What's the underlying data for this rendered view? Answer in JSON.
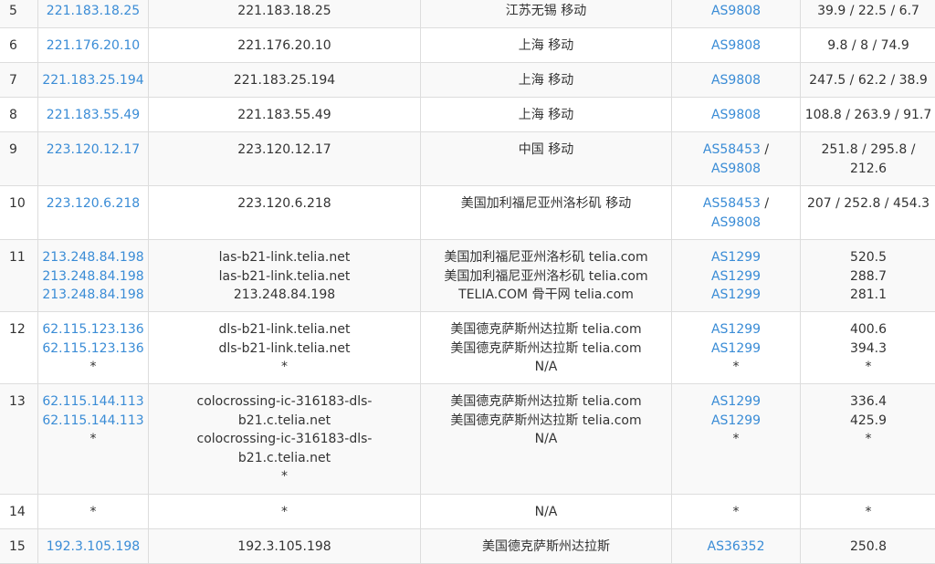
{
  "colors": {
    "link": "#3a8cd6",
    "text": "#333333",
    "row_stripe": "#f9f9f9",
    "border": "#dddddd"
  },
  "rows": [
    {
      "hop": "5",
      "ips": [
        "221.183.18.25"
      ],
      "hosts": [
        "221.183.18.25"
      ],
      "locations": [
        "江苏无锡 移动"
      ],
      "asn": [
        "AS9808"
      ],
      "times": [
        "39.9 / 22.5 / 6.7"
      ]
    },
    {
      "hop": "6",
      "ips": [
        "221.176.20.10"
      ],
      "hosts": [
        "221.176.20.10"
      ],
      "locations": [
        "上海 移动"
      ],
      "asn": [
        "AS9808"
      ],
      "times": [
        "9.8 / 8 / 74.9"
      ]
    },
    {
      "hop": "7",
      "ips": [
        "221.183.25.194"
      ],
      "hosts": [
        "221.183.25.194"
      ],
      "locations": [
        "上海 移动"
      ],
      "asn": [
        "AS9808"
      ],
      "times": [
        "247.5 / 62.2 / 38.9"
      ]
    },
    {
      "hop": "8",
      "ips": [
        "221.183.55.49"
      ],
      "hosts": [
        "221.183.55.49"
      ],
      "locations": [
        "上海 移动"
      ],
      "asn": [
        "AS9808"
      ],
      "times": [
        "108.8 / 263.9 / 91.7"
      ]
    },
    {
      "hop": "9",
      "ips": [
        "223.120.12.17"
      ],
      "hosts": [
        "223.120.12.17"
      ],
      "locations": [
        "中国 移动"
      ],
      "asn": [
        "AS58453",
        "AS9808"
      ],
      "times": [
        "251.8 / 295.8 /",
        "212.6"
      ]
    },
    {
      "hop": "10",
      "ips": [
        "223.120.6.218"
      ],
      "hosts": [
        "223.120.6.218"
      ],
      "locations": [
        "美国加利福尼亚州洛杉矶 移动"
      ],
      "asn": [
        "AS58453",
        "AS9808"
      ],
      "times": [
        "207 / 252.8 / 454.3"
      ]
    },
    {
      "hop": "11",
      "ips": [
        "213.248.84.198",
        "213.248.84.198",
        "213.248.84.198"
      ],
      "hosts": [
        "las-b21-link.telia.net",
        "las-b21-link.telia.net",
        "213.248.84.198"
      ],
      "locations": [
        "美国加利福尼亚州洛杉矶 telia.com",
        "美国加利福尼亚州洛杉矶 telia.com",
        "TELIA.COM 骨干网 telia.com"
      ],
      "asn": [
        "AS1299",
        "AS1299",
        "AS1299"
      ],
      "times": [
        "520.5",
        "288.7",
        "281.1"
      ]
    },
    {
      "hop": "12",
      "ips": [
        "62.115.123.136",
        "62.115.123.136",
        "*"
      ],
      "hosts": [
        "dls-b21-link.telia.net",
        "dls-b21-link.telia.net",
        "*"
      ],
      "locations": [
        "美国德克萨斯州达拉斯 telia.com",
        "美国德克萨斯州达拉斯 telia.com",
        "N/A"
      ],
      "asn": [
        "AS1299",
        "AS1299",
        "*"
      ],
      "times": [
        "400.6",
        "394.3",
        "*"
      ]
    },
    {
      "hop": "13",
      "ips": [
        "62.115.144.113",
        "62.115.144.113",
        "*"
      ],
      "hosts": [
        "colocrossing-ic-316183-dls-b21.c.telia.net",
        "colocrossing-ic-316183-dls-b21.c.telia.net",
        "*"
      ],
      "locations": [
        "美国德克萨斯州达拉斯 telia.com",
        "美国德克萨斯州达拉斯 telia.com",
        "N/A"
      ],
      "asn": [
        "AS1299",
        "AS1299",
        "*"
      ],
      "times": [
        "336.4",
        "425.9",
        "*"
      ]
    },
    {
      "hop": "14",
      "ips": [
        "*"
      ],
      "hosts": [
        "*"
      ],
      "locations": [
        "N/A"
      ],
      "asn": [
        "*"
      ],
      "times": [
        "*"
      ]
    },
    {
      "hop": "15",
      "ips": [
        "192.3.105.198"
      ],
      "hosts": [
        "192.3.105.198"
      ],
      "locations": [
        "美国德克萨斯州达拉斯"
      ],
      "asn": [
        "AS36352"
      ],
      "times": [
        "250.8"
      ]
    }
  ]
}
